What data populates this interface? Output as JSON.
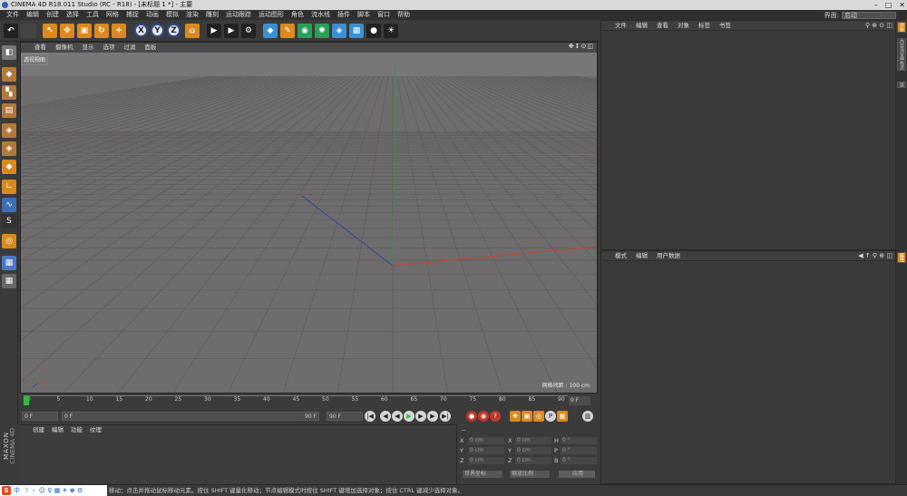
{
  "window": {
    "title": "CINEMA 4D R18.011 Studio (RC - R18) - [未标题 1 *] - 主要"
  },
  "menubar": {
    "items": [
      "文件",
      "编辑",
      "创建",
      "选择",
      "工具",
      "网格",
      "捕捉",
      "动画",
      "模拟",
      "渲染",
      "雕刻",
      "运动跟踪",
      "运动图形",
      "角色",
      "流水线",
      "插件",
      "脚本",
      "窗口",
      "帮助"
    ]
  },
  "layout": {
    "label": "界面:",
    "value": "启动"
  },
  "toolbar": {
    "buttons": [
      {
        "name": "undo",
        "glyph": "↶"
      },
      {
        "name": "redo",
        "glyph": ""
      },
      {
        "name": "live-selection",
        "glyph": "↖"
      },
      {
        "name": "move",
        "glyph": "✥"
      },
      {
        "name": "scale",
        "glyph": "▣"
      },
      {
        "name": "rotate",
        "glyph": "↻"
      },
      {
        "name": "recent-tools",
        "glyph": "+"
      },
      {
        "name": "x-axis",
        "glyph": "X"
      },
      {
        "name": "y-axis",
        "glyph": "Y"
      },
      {
        "name": "z-axis",
        "glyph": "Z"
      },
      {
        "name": "coordinate-system",
        "glyph": "⌂"
      },
      {
        "name": "render-view",
        "glyph": "▶"
      },
      {
        "name": "render-picture-viewer",
        "glyph": "▶"
      },
      {
        "name": "render-settings",
        "glyph": "⚙"
      },
      {
        "name": "cube",
        "glyph": "◆"
      },
      {
        "name": "spline-pen",
        "glyph": "✎"
      },
      {
        "name": "subdivision-surface",
        "glyph": "◉"
      },
      {
        "name": "array",
        "glyph": "✺"
      },
      {
        "name": "deformer",
        "glyph": "◈"
      },
      {
        "name": "floor",
        "glyph": "▦"
      },
      {
        "name": "camera",
        "glyph": "●"
      },
      {
        "name": "light",
        "glyph": "☀"
      }
    ]
  },
  "viewport": {
    "menu": [
      "查看",
      "摄像机",
      "显示",
      "选项",
      "过滤",
      "面板"
    ],
    "label": "透视视图",
    "grid_info": "网格间距 : 100 cm",
    "icons": "✥↕⊙◫"
  },
  "timeline": {
    "ticks": [
      "0",
      "5",
      "10",
      "15",
      "20",
      "25",
      "30",
      "35",
      "40",
      "45",
      "50",
      "55",
      "60",
      "65",
      "70",
      "75",
      "80",
      "85",
      "90"
    ],
    "current_frame": "0 F"
  },
  "transport": {
    "start_field": "0 F",
    "range_start": "0 F",
    "range_end": "90 F",
    "end_field": "90 F"
  },
  "materials": {
    "menu": [
      "创建",
      "编辑",
      "功能",
      "纹理"
    ]
  },
  "coords": {
    "header": "--",
    "rows": [
      {
        "axis": "X",
        "pos": "0 cm",
        "axis2": "X",
        "size": "0 cm",
        "axis3": "H",
        "rot": "0 °"
      },
      {
        "axis": "Y",
        "pos": "0 cm",
        "axis2": "Y",
        "size": "0 cm",
        "axis3": "P",
        "rot": "0 °"
      },
      {
        "axis": "Z",
        "pos": "0 cm",
        "axis2": "Z",
        "size": "0 cm",
        "axis3": "B",
        "rot": "0 °"
      }
    ],
    "mode1": "世界坐标",
    "mode2": "缩放比例",
    "apply": "应用"
  },
  "objects_panel": {
    "menu": [
      "文件",
      "编辑",
      "查看",
      "对象",
      "标签",
      "书签"
    ],
    "icons": "⚲ ⊕ ⊙ ◫"
  },
  "attributes_panel": {
    "menu": [
      "模式",
      "编辑",
      "用户数据"
    ],
    "icons": "◀ ↑ ⚲ ⊕ ◫"
  },
  "right_tabs": [
    "对象",
    "内容浏览器",
    "构造",
    "层"
  ],
  "attr_tab": "属性",
  "maxon": {
    "brand": "MAXON",
    "product": "CINEMA 4D"
  },
  "ime": {
    "logo": "S",
    "lang": "中",
    "icons": "☽ ・ ☺ ♀ ▦ ✈ ♚ ⚙"
  },
  "status": {
    "text": "移动：点击并拖动鼠标移动元素。按住 SHIFT 键量化移动；节点编辑模式时按住 SHIFT 键增加选择对象；按住 CTRL 键减少选择对象。"
  },
  "colors": {
    "accent": "#d98a1e",
    "viewport_bg": "#6f6c6e",
    "x_axis": "#c8442b",
    "y_axis": "#2f9b3c",
    "z_axis": "#3542a3"
  }
}
